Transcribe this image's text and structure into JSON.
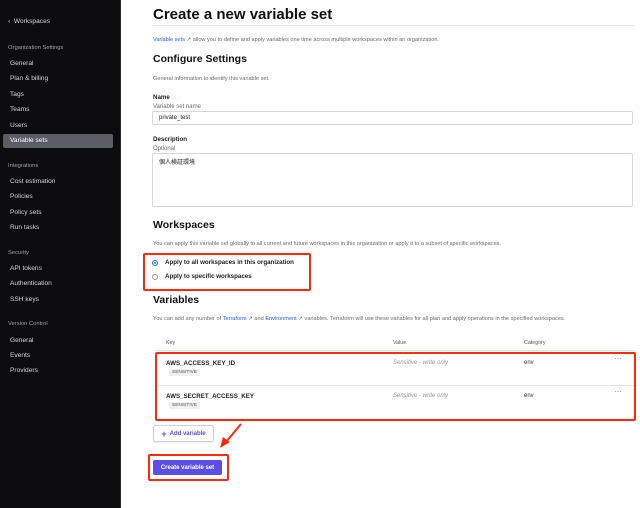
{
  "sidebar": {
    "back": "Workspaces",
    "sections": [
      {
        "title": "Organization Settings",
        "items": [
          "General",
          "Plan & billing",
          "Tags",
          "Teams",
          "Users",
          "Variable sets"
        ]
      },
      {
        "title": "Integrations",
        "items": [
          "Cost estimation",
          "Policies",
          "Policy sets",
          "Run tasks"
        ]
      },
      {
        "title": "Security",
        "items": [
          "API tokens",
          "Authentication",
          "SSH keys"
        ]
      },
      {
        "title": "Version Control",
        "items": [
          "General",
          "Events",
          "Providers"
        ]
      }
    ],
    "active": "Variable sets"
  },
  "page": {
    "title": "Create a new variable set",
    "intro_link": "Variable sets",
    "intro_text": " allow you to define and apply variables one time across multiple workspaces within an organization.",
    "configure": {
      "heading": "Configure Settings",
      "desc": "General information to identify this variable set.",
      "name_label": "Name",
      "name_help": "Variable set name",
      "name_value": "private_test",
      "desc_label": "Description",
      "desc_help": "Optional",
      "desc_value": "個人検証環境"
    },
    "workspaces": {
      "heading": "Workspaces",
      "desc": "You can apply this variable set globally to all current and future workspaces in this organization or apply it to a subset of specific workspaces.",
      "options": [
        "Apply to all workspaces in this organization",
        "Apply to specific workspaces"
      ],
      "selected": 0
    },
    "variables": {
      "heading": "Variables",
      "desc_pre": "You can add any number of ",
      "link1": "Terraform",
      "desc_mid": " and ",
      "link2": "Environment",
      "desc_post": " variables. Terraform will use these variables for all plan and apply operations in the specified workspaces.",
      "columns": [
        "Key",
        "Value",
        "Category"
      ],
      "rows": [
        {
          "key": "AWS_ACCESS_KEY_ID",
          "badge": "SENSITIVE",
          "value": "Sensitive - write only",
          "category": "env"
        },
        {
          "key": "AWS_SECRET_ACCESS_KEY",
          "badge": "SENSITIVE",
          "value": "Sensitive - write only",
          "category": "env"
        }
      ],
      "add_label": "Add variable"
    },
    "create_label": "Create variable set"
  },
  "colors": {
    "accent": "#5b4ee6",
    "annotation": "#ff2a0a",
    "link": "#2563eb"
  }
}
